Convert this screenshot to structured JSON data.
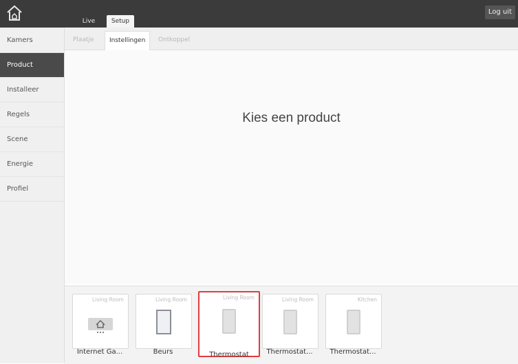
{
  "topbar": {
    "logo_icon": "house-logo-icon",
    "tabs": [
      {
        "label": "Live"
      },
      {
        "label": "Setup"
      }
    ],
    "logout_label": "Log uit"
  },
  "sidebar": {
    "items": [
      {
        "label": "Kamers"
      },
      {
        "label": "Product"
      },
      {
        "label": "Installeer"
      },
      {
        "label": "Regels"
      },
      {
        "label": "Scene"
      },
      {
        "label": "Energie"
      },
      {
        "label": "Profiel"
      }
    ],
    "active": "Product"
  },
  "subtabs": [
    {
      "label": "Plaatje"
    },
    {
      "label": "Instellingen"
    },
    {
      "label": "Ontkoppel"
    }
  ],
  "main": {
    "heading": "Kies een product"
  },
  "products": [
    {
      "room": "Living Room",
      "name": "Internet Ga...",
      "icon": "gateway-icon"
    },
    {
      "room": "Living Room",
      "name": "Beurs",
      "icon": "panel-icon"
    },
    {
      "room": "Living Room",
      "name": "Thermostat",
      "icon": "thermostat-icon",
      "selected": true
    },
    {
      "room": "Living Room",
      "name": "Thermostat...",
      "icon": "thermostat-icon"
    },
    {
      "room": "Kitchen",
      "name": "Thermostat...",
      "icon": "thermostat-icon"
    }
  ],
  "colors": {
    "topbar": "#3b3b3b",
    "sidebar_active": "#4a4a4a",
    "selection": "#e03c3c"
  }
}
